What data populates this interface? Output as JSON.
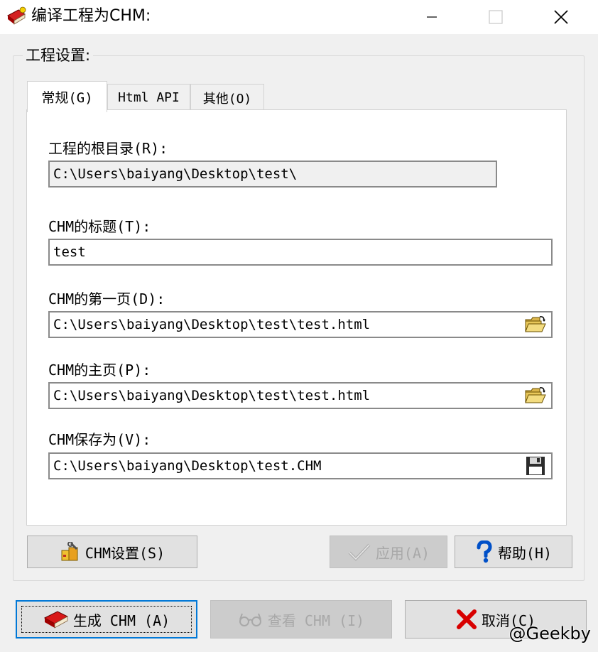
{
  "window": {
    "title": "编译工程为CHM:",
    "minimize_glyph": "—",
    "maximize_glyph": "☐",
    "close_glyph": "✕"
  },
  "group": {
    "label": "工程设置:"
  },
  "tabs": [
    {
      "label": "常规(G)",
      "active": true
    },
    {
      "label": "Html API",
      "active": false
    },
    {
      "label": "其他(O)",
      "active": false
    }
  ],
  "fields": {
    "root_dir": {
      "label": "工程的根目录(R):",
      "value": "C:\\Users\\baiyang\\Desktop\\test\\"
    },
    "chm_title": {
      "label": "CHM的标题(T):",
      "value": "test"
    },
    "first_page": {
      "label": "CHM的第一页(D):",
      "value": "C:\\Users\\baiyang\\Desktop\\test\\test.html"
    },
    "home_page": {
      "label": "CHM的主页(P):",
      "value": "C:\\Users\\baiyang\\Desktop\\test\\test.html"
    },
    "save_as": {
      "label": "CHM保存为(V):",
      "value": "C:\\Users\\baiyang\\Desktop\\test.CHM"
    }
  },
  "panel_buttons": {
    "chm_settings": "CHM设置(S)",
    "apply": "应用(A)",
    "help": "帮助(H)"
  },
  "bottom_buttons": {
    "generate": "生成 CHM (A)",
    "view": "查看 CHM (I)",
    "cancel": "取消(C)"
  },
  "watermark": "@Geekby",
  "icons": {
    "app": "red-book-icon",
    "browse_first_page": "open-folder-icon",
    "browse_home_page": "open-folder-icon",
    "save_as": "floppy-disk-icon",
    "chm_settings": "settings-box-icon",
    "apply": "checkmark-icon",
    "help": "question-mark-icon",
    "generate": "red-book-icon",
    "view": "glasses-icon",
    "cancel": "red-x-icon"
  },
  "colors": {
    "accent_border": "#0078d7",
    "cancel_icon": "#d80000",
    "help_icon": "#0050c8"
  }
}
